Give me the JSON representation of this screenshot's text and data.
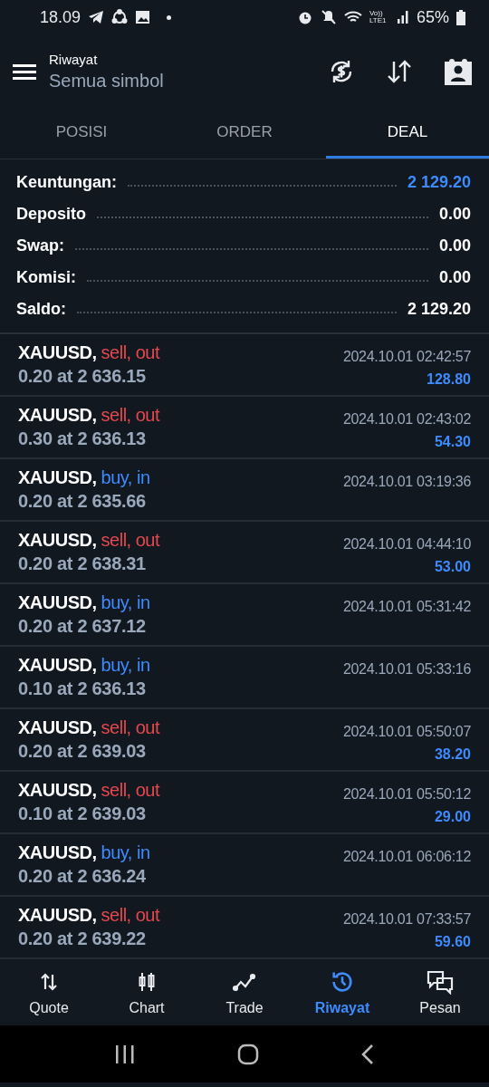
{
  "status_bar": {
    "time": "18.09",
    "network": "Vo)) LTE1",
    "battery": "65%"
  },
  "header": {
    "title": "Riwayat",
    "subtitle": "Semua simbol"
  },
  "tabs": [
    {
      "label": "POSISI",
      "selected": false
    },
    {
      "label": "ORDER",
      "selected": false
    },
    {
      "label": "DEAL",
      "selected": true
    }
  ],
  "summary": [
    {
      "label": "Keuntungan:",
      "value": "2 129.20",
      "accent": true
    },
    {
      "label": "Deposito",
      "value": "0.00",
      "accent": false
    },
    {
      "label": "Swap:",
      "value": "0.00",
      "accent": false
    },
    {
      "label": "Komisi:",
      "value": "0.00",
      "accent": false
    },
    {
      "label": "Saldo:",
      "value": "2 129.20",
      "accent": false
    }
  ],
  "deals": [
    {
      "symbol": "XAUUSD,",
      "action": "sell, out",
      "color": "#e5484d",
      "volume": "0.20 at 2 636.15",
      "time": "2024.10.01 02:42:57",
      "profit": "128.80"
    },
    {
      "symbol": "XAUUSD,",
      "action": "sell, out",
      "color": "#e5484d",
      "volume": "0.30 at 2 636.13",
      "time": "2024.10.01 02:43:02",
      "profit": "54.30"
    },
    {
      "symbol": "XAUUSD,",
      "action": "buy, in",
      "color": "#3d8bfd",
      "volume": "0.20 at 2 635.66",
      "time": "2024.10.01 03:19:36"
    },
    {
      "symbol": "XAUUSD,",
      "action": "sell, out",
      "color": "#e5484d",
      "volume": "0.20 at 2 638.31",
      "time": "2024.10.01 04:44:10",
      "profit": "53.00"
    },
    {
      "symbol": "XAUUSD,",
      "action": "buy, in",
      "color": "#3d8bfd",
      "volume": "0.20 at 2 637.12",
      "time": "2024.10.01 05:31:42"
    },
    {
      "symbol": "XAUUSD,",
      "action": "buy, in",
      "color": "#3d8bfd",
      "volume": "0.10 at 2 636.13",
      "time": "2024.10.01 05:33:16"
    },
    {
      "symbol": "XAUUSD,",
      "action": "sell, out",
      "color": "#e5484d",
      "volume": "0.20 at 2 639.03",
      "time": "2024.10.01 05:50:07",
      "profit": "38.20"
    },
    {
      "symbol": "XAUUSD,",
      "action": "sell, out",
      "color": "#e5484d",
      "volume": "0.10 at 2 639.03",
      "time": "2024.10.01 05:50:12",
      "profit": "29.00"
    },
    {
      "symbol": "XAUUSD,",
      "action": "buy, in",
      "color": "#3d8bfd",
      "volume": "0.20 at 2 636.24",
      "time": "2024.10.01 06:06:12"
    },
    {
      "symbol": "XAUUSD,",
      "action": "sell, out",
      "color": "#e5484d",
      "volume": "0.20 at 2 639.22",
      "time": "2024.10.01 07:33:57",
      "profit": "59.60"
    }
  ],
  "bottom_nav": [
    {
      "label": "Quote",
      "kind": "quote",
      "selected": false
    },
    {
      "label": "Chart",
      "kind": "chart",
      "selected": false
    },
    {
      "label": "Trade",
      "kind": "trade",
      "selected": false
    },
    {
      "label": "Riwayat",
      "kind": "history",
      "selected": true
    },
    {
      "label": "Pesan",
      "kind": "messages",
      "selected": false
    }
  ]
}
